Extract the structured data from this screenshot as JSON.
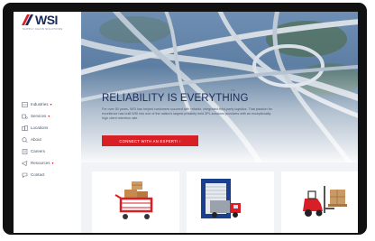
{
  "brand": {
    "name": "WSI",
    "tagline": "SUPPLY CHAIN SOLUTIONS"
  },
  "nav": {
    "items": [
      {
        "label": "Industries",
        "icon": "industries-icon",
        "has_dropdown": true
      },
      {
        "label": "Services",
        "icon": "services-icon",
        "has_dropdown": true
      },
      {
        "label": "Locations",
        "icon": "locations-icon",
        "has_dropdown": false
      },
      {
        "label": "About",
        "icon": "about-icon",
        "has_dropdown": false
      },
      {
        "label": "Careers",
        "icon": "careers-icon",
        "has_dropdown": false
      },
      {
        "label": "Resources",
        "icon": "resources-icon",
        "has_dropdown": true
      },
      {
        "label": "Contact",
        "icon": "contact-icon",
        "has_dropdown": false
      }
    ],
    "dropdown_caret": "▾"
  },
  "hero": {
    "title": "RELIABILITY IS EVERYTHING",
    "trademark": "TM",
    "body": "For over 50 years, WSI has helped customers succeed with reliable, integrated third-party logistics. That passion for excellence has built WSI into one of the nation's largest privately held 3PL solutions providers with an exceptionally high client retention rate.",
    "cta_label": "CONNECT WITH AN EXPERT!  ›"
  },
  "cards": [
    {
      "icon": "shopping-cart-boxes-icon"
    },
    {
      "icon": "loading-dock-truck-icon"
    },
    {
      "icon": "forklift-pallet-icon"
    }
  ],
  "colors": {
    "accent_red": "#d91f26",
    "navy": "#1b2a59"
  }
}
